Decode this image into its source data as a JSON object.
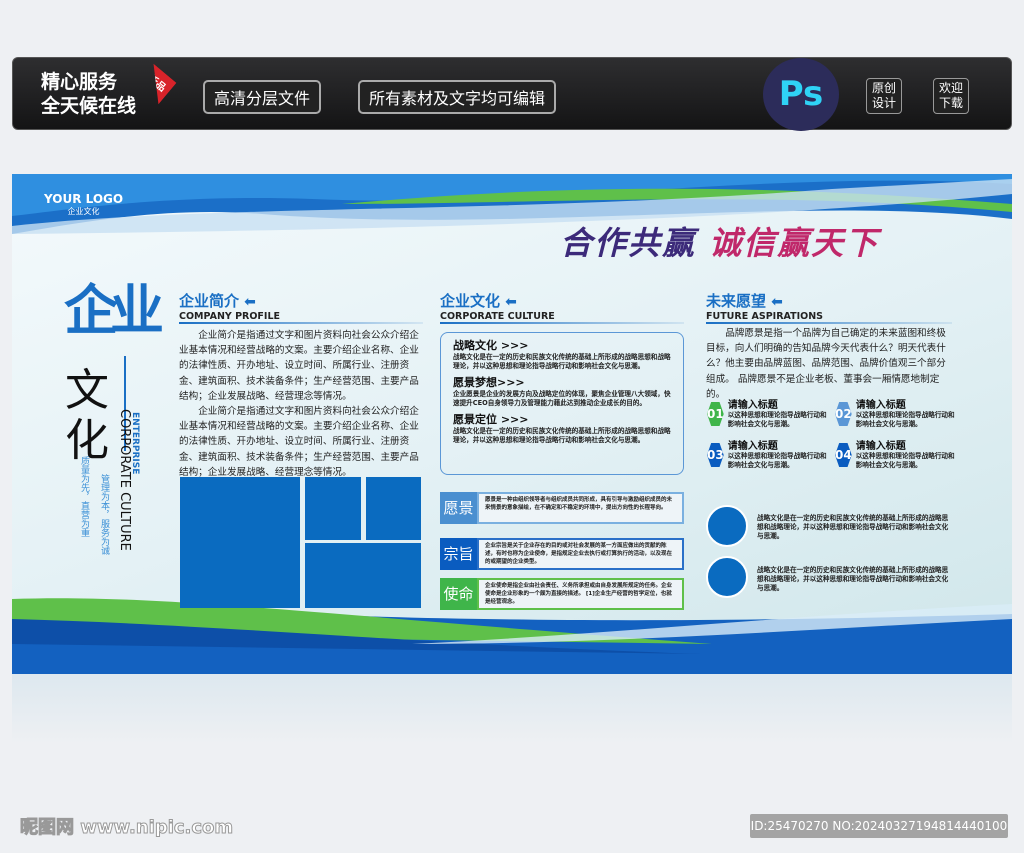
{
  "topbar": {
    "slogan_line1": "精心服务",
    "slogan_line2": "全天候在线",
    "new_badge": "新品",
    "button1": "高清分层文件",
    "button2": "所有素材及文字均可编辑",
    "ps_logo": "Ps",
    "badge1": "原创设计",
    "badge2": "欢迎下载"
  },
  "board": {
    "logo": "YOUR LOGO",
    "logo_sub": "企业文化",
    "slogan_a": "合作共赢",
    "slogan_b": "诚信赢天下",
    "side": {
      "big1": "企业",
      "big2": "文化",
      "en1": "ENTERPRISE",
      "en2": "CORPORATE CULTURE",
      "motto1": "管理为本，服务为诚",
      "motto2": "质量为先，直营为重"
    },
    "col1": {
      "title": "企业简介",
      "subtitle": "COMPANY PROFILE",
      "paragraphs": [
        "企业简介是指通过文字和图片资料向社会公众介绍企业基本情况和经营战略的文案。主要介绍企业名称、企业的法律性质、开办地址、设立时间、所属行业、注册资金、建筑面积、技术装备条件；生产经营范围、主要产品结构；企业发展战略、经营理念等情况。",
        "企业简介是指通过文字和图片资料向社会公众介绍企业基本情况和经营战略的文案。主要介绍企业名称、企业的法律性质、开办地址、设立时间、所属行业、注册资金、建筑面积、技术装备条件；生产经营范围、主要产品结构；企业发展战略、经营理念等情况。"
      ]
    },
    "col2": {
      "title": "企业文化",
      "subtitle": "CORPORATE CULTURE",
      "items": [
        {
          "heading": "战略文化 >>>",
          "text": "战略文化是在一定的历史和民族文化传统的基础上所形成的战略思想和战略理论，并以这种思想和理论指导战略行动和影响社会文化与思潮。"
        },
        {
          "heading": "愿景梦想>>>",
          "text": "企业愿景是企业的发展方向及战略定位的体现，聚焦企业管理八大领域，快速提升CEO自身领导力及管理能力藉此达到推动企业成长的目的。"
        },
        {
          "heading": "愿景定位 >>>",
          "text": "战略文化是在一定的历史和民族文化传统的基础上所形成的战略思想和战略理论，并以这种思想和理论指导战略行动和影响社会文化与思潮。"
        }
      ],
      "labels": [
        {
          "label": "愿景",
          "color": "#4a8fd0",
          "text": "愿景是一种由组织领导者与组织成员共同形成，具有引导与激励组织成员的未来情景的意象描绘，在不确定和不稳定的环境中，提出方向性的长程导向。"
        },
        {
          "label": "宗旨",
          "color": "#0a5cc0",
          "text": "企业宗旨是关于企业存在的目的或对社会发展的某一方面应做出的贡献的陈述，有时也称为企业使命，是指规定企业去执行或打算执行的活动，以及现在的或期望的企业类型。"
        },
        {
          "label": "使命",
          "color": "#3fb54a",
          "text": "企业使命是指企业由社会责任、义务所承担或由自身发展所规定的任务。企业使命是企业形象的一个颇为直接的描述。 [1]企业生产经营的哲学定位，也就是经营观念。"
        }
      ]
    },
    "col3": {
      "title": "未来愿望",
      "subtitle": "FUTURE ASPIRATIONS",
      "paragraph": "品牌愿景是指一个品牌为自己确定的未来蓝图和终极目标，向人们明确的告知品牌今天代表什么？明天代表什么？他主要由品牌蓝图、品牌范围、品牌价值观三个部分组成。 品牌愿景不是企业老板、董事会一厢情愿地制定的。",
      "items": [
        {
          "num": "01",
          "title": "请输入标题",
          "text": "以这种思想和理论指导战略行动和影响社会文化与思潮。",
          "color": "#3fb54a"
        },
        {
          "num": "02",
          "title": "请输入标题",
          "text": "以这种思想和理论指导战略行动和影响社会文化与思潮。",
          "color": "#5b97d6"
        },
        {
          "num": "03",
          "title": "请输入标题",
          "text": "以这种思想和理论指导战略行动和影响社会文化与思潮。",
          "color": "#0a5cc0"
        },
        {
          "num": "04",
          "title": "请输入标题",
          "text": "以这种思想和理论指导战略行动和影响社会文化与思潮。",
          "color": "#0a5cc0"
        }
      ],
      "circle_texts": [
        "战略文化是在一定的历史和民族文化传统的基础上所形成的战略思想和战略理论，并以这种思想和理论指导战略行动和影响社会文化与思潮。",
        "战略文化是在一定的历史和民族文化传统的基础上所形成的战略思想和战略理论，并以这种思想和理论指导战略行动和影响社会文化与思潮。"
      ]
    }
  },
  "footer": {
    "watermark": "昵图网 www.nipic.com",
    "id_text": "ID:25470270 NO:20240327194814440100"
  }
}
